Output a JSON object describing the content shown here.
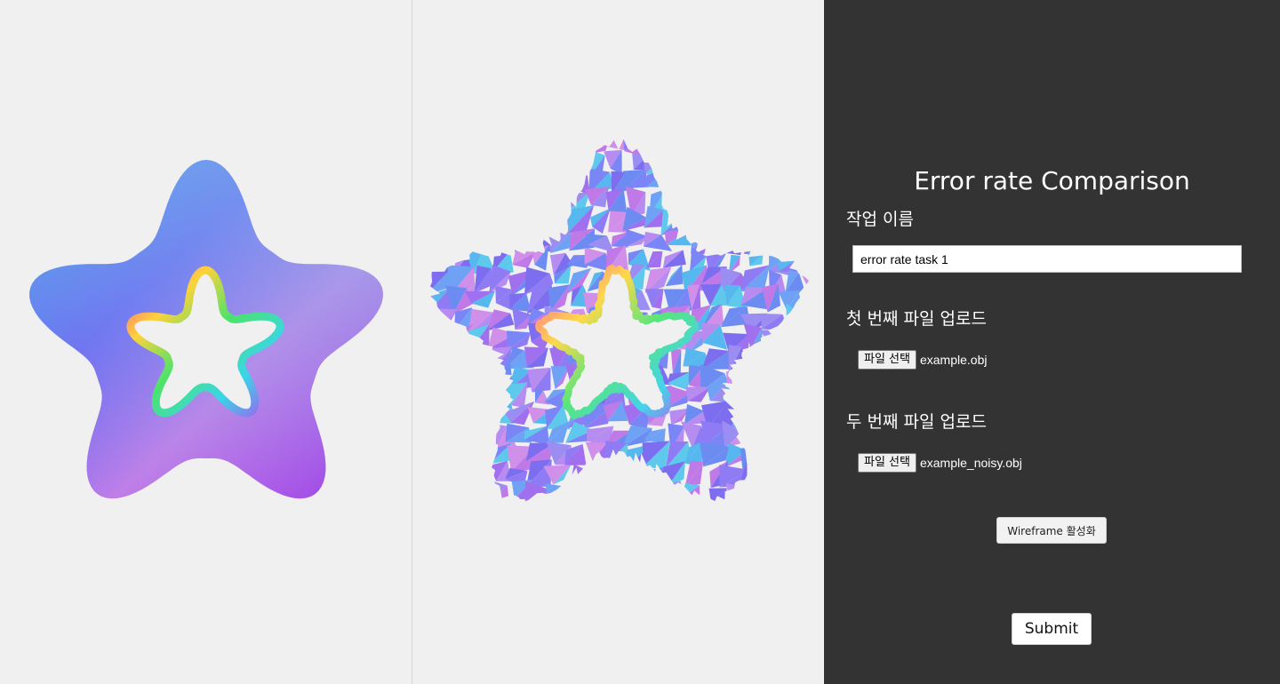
{
  "panel": {
    "title": "Error rate Comparison",
    "task_name": {
      "label": "작업 이름",
      "value": "error rate task 1"
    },
    "first_file": {
      "label": "첫 번째 파일 업로드",
      "button_label": "파일 선택",
      "file_name": "example.obj"
    },
    "second_file": {
      "label": "두 번째 파일 업로드",
      "button_label": "파일 선택",
      "file_name": "example_noisy.obj"
    },
    "wireframe_button_label": "Wireframe 활성화",
    "submit_label": "Submit"
  },
  "colors": {
    "viewport_background": "#f0f0f0",
    "panel_background": "#333333",
    "panel_text": "#ffffff",
    "mesh_top": "#7fc6ec",
    "mesh_left": "#3f86ea",
    "mesh_center": "#6a5cf2",
    "mesh_right": "#c07ee8",
    "mesh_bottom_right": "#9a3de6"
  },
  "viewports": [
    {
      "name": "original-mesh-view",
      "render_style": "smooth"
    },
    {
      "name": "noisy-mesh-view",
      "render_style": "faceted-noisy"
    }
  ]
}
